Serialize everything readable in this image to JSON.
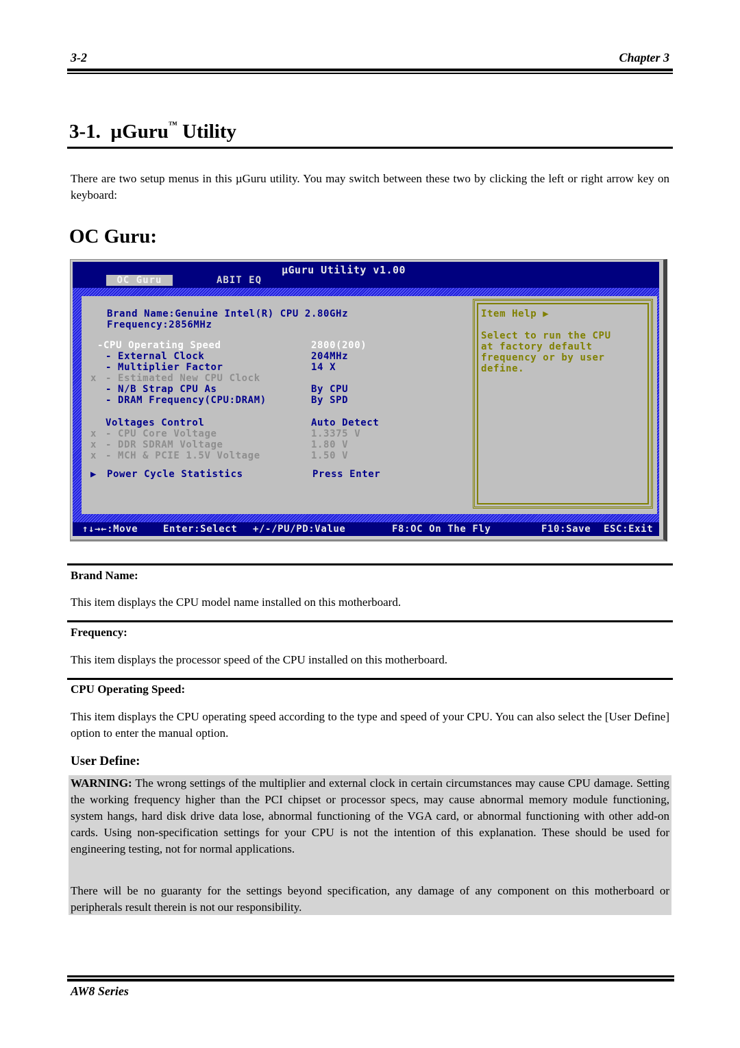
{
  "header": {
    "page_number": "3-2",
    "chapter": "Chapter 3"
  },
  "section": {
    "number": "3-1.",
    "title_prefix": "µGuru",
    "trademark": "™",
    "title_suffix": "Utility",
    "intro": "There are two setup menus in this µGuru utility. You may switch between these two by clicking the left or right arrow key on keyboard:"
  },
  "oc_guru_heading": "OC Guru:",
  "bios": {
    "title": "µGuru Utility v1.00",
    "tabs": [
      {
        "label": "OC Guru",
        "active": true
      },
      {
        "label": "ABIT EQ",
        "active": false
      }
    ],
    "brand_line": "Brand Name:Genuine Intel(R) CPU 2.80GHz",
    "frequency_line": "Frequency:2856MHz",
    "items": [
      {
        "prefix": "",
        "label": "-CPU Operating Speed",
        "value": "2800(200)",
        "state": "selected"
      },
      {
        "prefix": "",
        "label": "- External Clock",
        "value": "204MHz",
        "state": "normal"
      },
      {
        "prefix": "",
        "label": "- Multiplier Factor",
        "value": "14 X",
        "state": "normal"
      },
      {
        "prefix": "x",
        "label": "- Estimated New CPU Clock",
        "value": "",
        "state": "disabled"
      },
      {
        "prefix": "",
        "label": "- N/B Strap CPU As",
        "value": "By CPU",
        "state": "normal"
      },
      {
        "prefix": "",
        "label": "- DRAM Frequency(CPU:DRAM)",
        "value": "By SPD",
        "state": "normal"
      }
    ],
    "voltage_items": [
      {
        "prefix": "",
        "label": "Voltages Control",
        "value": "Auto Detect",
        "state": "normal"
      },
      {
        "prefix": "x",
        "label": "- CPU Core Voltage",
        "value": "1.3375 V",
        "state": "disabled"
      },
      {
        "prefix": "x",
        "label": "- DDR SDRAM Voltage",
        "value": "1.80 V",
        "state": "disabled"
      },
      {
        "prefix": "x",
        "label": "- MCH & PCIE 1.5V Voltage",
        "value": "1.50 V",
        "state": "disabled"
      }
    ],
    "submenu": {
      "arrow": "▶",
      "label": "Power Cycle Statistics",
      "value": "Press Enter"
    },
    "help": {
      "title": "Item Help ▶",
      "text": "Select to run the CPU\nat factory default\nfrequency or by user\ndefine."
    },
    "status_bar": [
      "↑↓→←:Move",
      "Enter:Select",
      "+/-/PU/PD:Value",
      "F8:OC On The Fly",
      "F10:Save",
      "ESC:Exit"
    ],
    "colors": {
      "background": "#00007f",
      "panel": "#c0c0c0",
      "item_text": "#00008b",
      "disabled_text": "#8e8e8e",
      "help_text": "#808000"
    }
  },
  "descriptions": [
    {
      "label": "Brand Name:",
      "text": "This item displays the CPU model name installed on this motherboard."
    },
    {
      "label": "Frequency:",
      "text": "This item displays the processor speed of the CPU installed on this motherboard."
    },
    {
      "label": "CPU Operating Speed:",
      "text": "This item displays the CPU operating speed according to the type and speed of your CPU. You can also select the [User Define] option to enter the manual option."
    }
  ],
  "user_define": {
    "heading": "User Define:",
    "warning_label": "WARNING:",
    "warning_text": " The wrong settings of the multiplier and external clock in certain circumstances may cause CPU damage. Setting the working frequency higher than the PCI chipset or processor specs, may cause abnormal memory module functioning, system hangs, hard disk drive data lose, abnormal functioning of the VGA card, or abnormal functioning with other add-on cards. Using non-specification settings for your CPU is not the intention of this explanation. These should be used for engineering testing, not for normal applications.",
    "disclaimer": "There will be no guaranty for the settings beyond specification, any damage of any component on this motherboard or peripherals result therein is not our responsibility."
  },
  "footer": {
    "series": "AW8 Series"
  }
}
